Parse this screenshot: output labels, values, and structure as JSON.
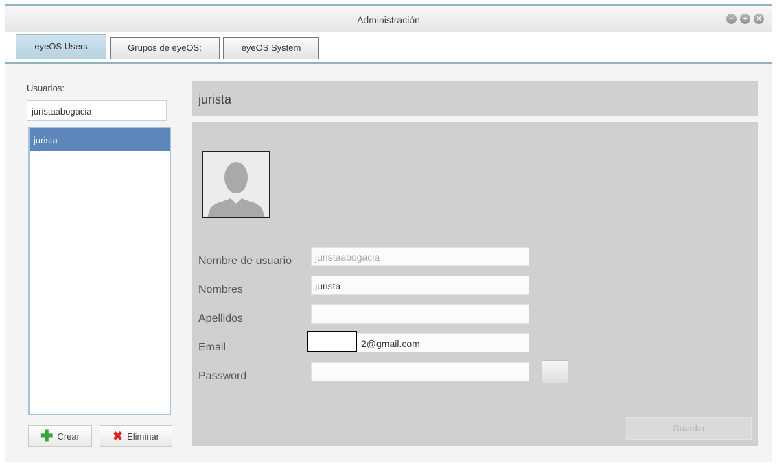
{
  "window": {
    "title": "Administración"
  },
  "tabs": [
    {
      "label": "eyeOS Users"
    },
    {
      "label": "Grupos de eyeOS:"
    },
    {
      "label": "eyeOS System"
    }
  ],
  "sidebar": {
    "label": "Usuarios:",
    "search_value": "juristaabogacia",
    "users": [
      {
        "label": "jurista"
      }
    ],
    "create_label": "Crear",
    "delete_label": "Eliminar"
  },
  "detail": {
    "header_name": "jurista",
    "fields": {
      "username": {
        "label": "Nombre de usuario",
        "value": "juristaabogacia"
      },
      "names": {
        "label": "Nombres",
        "value": "jurista"
      },
      "surnames": {
        "label": "Apellidos",
        "value": ""
      },
      "email": {
        "label": "Email",
        "value": "2@gmail.com"
      },
      "password": {
        "label": "Password",
        "value": ""
      }
    },
    "save_label": "Guardar"
  },
  "colors": {
    "accent": "#8fb3c3",
    "selection": "#5d86bb",
    "panel": "#d0d0d0"
  }
}
